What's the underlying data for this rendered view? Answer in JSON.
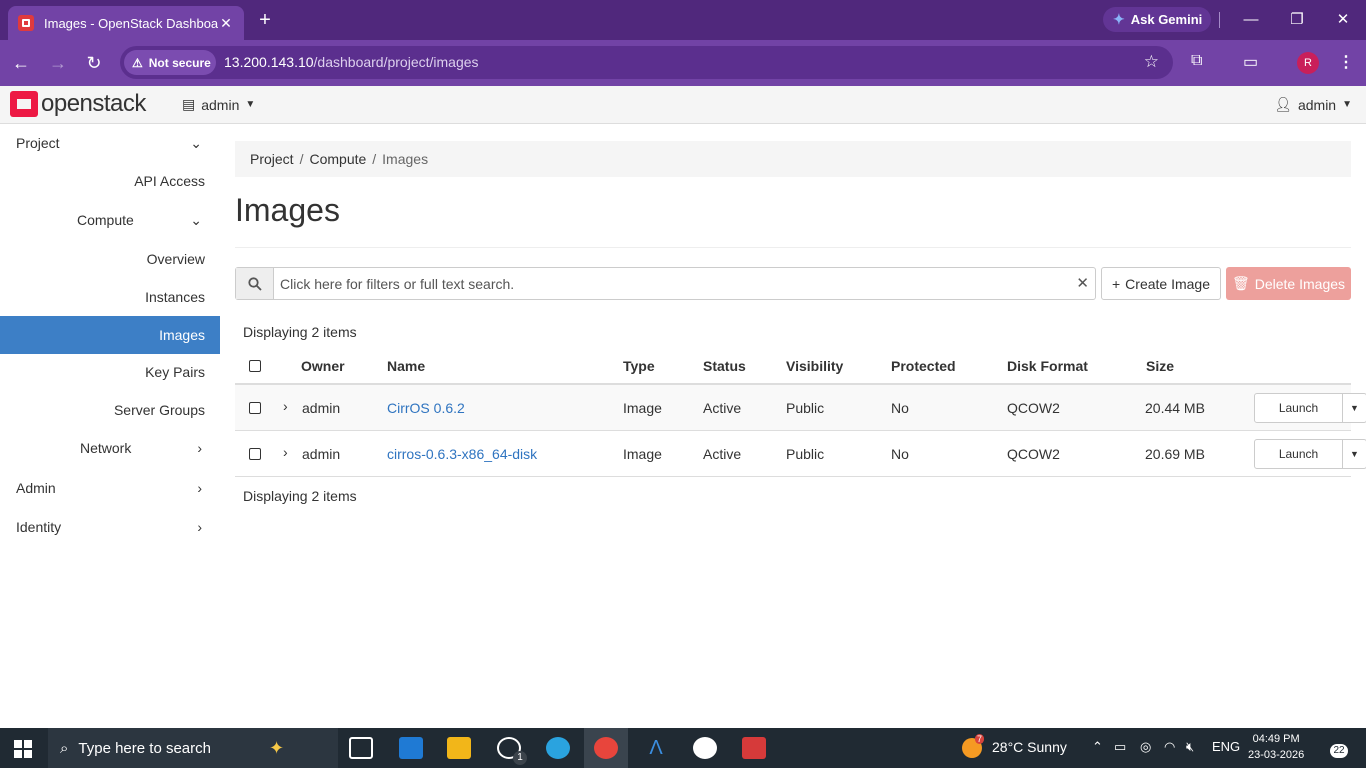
{
  "browser": {
    "tab_title": "Images - OpenStack Dashboard",
    "tab_close": "✕",
    "new_tab": "+",
    "ask_gemini": "Ask Gemini",
    "not_secure": "Not secure",
    "url_host": "13.200.143.10",
    "url_path": "/dashboard/project/images",
    "profile_initial": "R"
  },
  "header": {
    "logo_text": "openstack",
    "project_selector": "admin",
    "user_menu": "admin"
  },
  "sidebar": {
    "project": "Project",
    "api_access": "API Access",
    "compute": "Compute",
    "overview": "Overview",
    "instances": "Instances",
    "images": "Images",
    "key_pairs": "Key Pairs",
    "server_groups": "Server Groups",
    "network": "Network",
    "admin": "Admin",
    "identity": "Identity"
  },
  "breadcrumb": {
    "project": "Project",
    "compute": "Compute",
    "images": "Images"
  },
  "page": {
    "title": "Images",
    "search_placeholder": "Click here for filters or full text search.",
    "create_label": "Create Image",
    "delete_label": "Delete Images",
    "count_text": "Displaying 2 items"
  },
  "table": {
    "columns": {
      "owner": "Owner",
      "name": "Name",
      "type": "Type",
      "status": "Status",
      "visibility": "Visibility",
      "protected": "Protected",
      "disk_format": "Disk Format",
      "size": "Size"
    },
    "rows": [
      {
        "owner": "admin",
        "name": "CirrOS 0.6.2",
        "type": "Image",
        "status": "Active",
        "visibility": "Public",
        "protected": "No",
        "disk_format": "QCOW2",
        "size": "20.44 MB",
        "action": "Launch"
      },
      {
        "owner": "admin",
        "name": "cirros-0.6.3-x86_64-disk",
        "type": "Image",
        "status": "Active",
        "visibility": "Public",
        "protected": "No",
        "disk_format": "QCOW2",
        "size": "20.69 MB",
        "action": "Launch"
      }
    ]
  },
  "taskbar": {
    "search_placeholder": "Type here to search",
    "whatsapp_badge": "1",
    "weather_badge": "7",
    "weather": "28°C  Sunny",
    "language": "ENG",
    "time": "04:49 PM",
    "date": "23-03-2026",
    "notifications": "22"
  },
  "colors": {
    "tabbar": "#50287c",
    "addressbar": "#7243a6",
    "sidebar_active": "#3d7fc6",
    "link": "#2f74c0",
    "delete_button": "#eda09c",
    "openstack_red": "#ed1944"
  }
}
